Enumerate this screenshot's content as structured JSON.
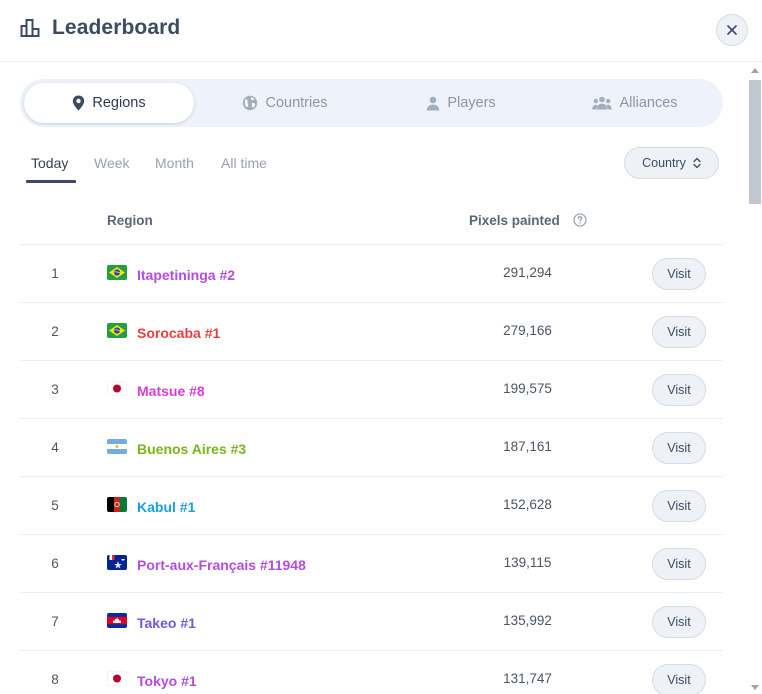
{
  "header": {
    "title": "Leaderboard",
    "icon": "bar-chart-icon",
    "close_icon": "close-icon"
  },
  "tabs": [
    {
      "label": "Regions",
      "icon": "map-pin-icon",
      "active": true
    },
    {
      "label": "Countries",
      "icon": "globe-icon",
      "active": false
    },
    {
      "label": "Players",
      "icon": "user-icon",
      "active": false
    },
    {
      "label": "Alliances",
      "icon": "users-icon",
      "active": false
    }
  ],
  "periods": [
    {
      "label": "Today",
      "active": true
    },
    {
      "label": "Week",
      "active": false
    },
    {
      "label": "Month",
      "active": false
    },
    {
      "label": "All time",
      "active": false
    }
  ],
  "filter": {
    "label": "Country",
    "icon": "chevron-up-down-icon"
  },
  "table": {
    "headers": {
      "region": "Region",
      "pixels": "Pixels painted"
    },
    "help_icon": "help-circle-icon",
    "visit_label": "Visit",
    "rows": [
      {
        "rank": "1",
        "flag": "brazil",
        "region": "Itapetininga #2",
        "color": "#b44ce0",
        "pixels": "291,294"
      },
      {
        "rank": "2",
        "flag": "brazil",
        "region": "Sorocaba #1",
        "color": "#e53e3e",
        "pixels": "279,166"
      },
      {
        "rank": "3",
        "flag": "japan",
        "region": "Matsue #8",
        "color": "#d63ed9",
        "pixels": "199,575"
      },
      {
        "rank": "4",
        "flag": "argentina",
        "region": "Buenos Aires #3",
        "color": "#7cb518",
        "pixels": "187,161"
      },
      {
        "rank": "5",
        "flag": "afghanistan",
        "region": "Kabul #1",
        "color": "#1aa0d8",
        "pixels": "152,628"
      },
      {
        "rank": "6",
        "flag": "french-southern-territories",
        "region": "Port-aux-Français #11948",
        "color": "#b44ce0",
        "pixels": "139,115"
      },
      {
        "rank": "7",
        "flag": "cambodia",
        "region": "Takeo #1",
        "color": "#6b5ae0",
        "pixels": "135,992"
      },
      {
        "rank": "8",
        "flag": "japan",
        "region": "Tokyo #1",
        "color": "#b44ce0",
        "pixels": "131,747"
      }
    ]
  }
}
